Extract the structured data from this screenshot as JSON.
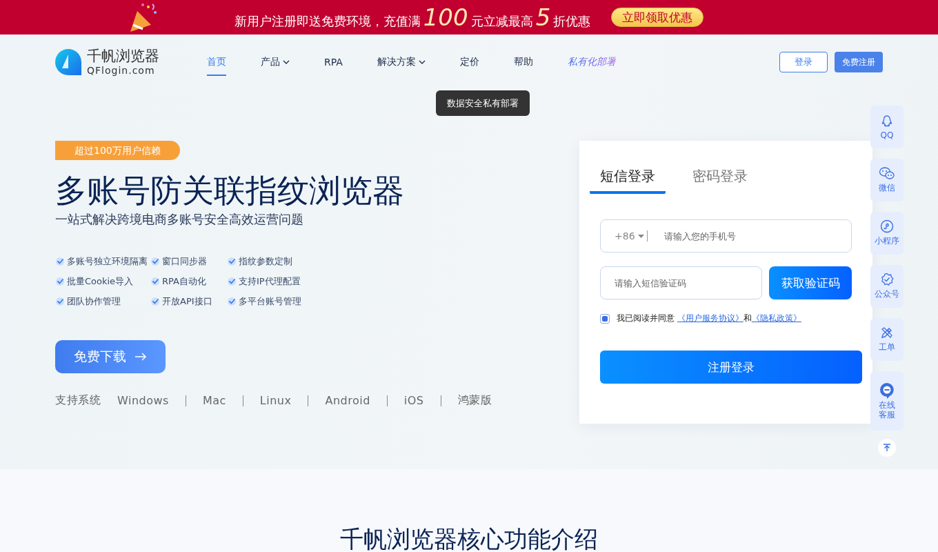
{
  "promo_banner": {
    "text_parts": [
      {
        "kind": "text",
        "text": "新用户注册即送免费环境，充值满"
      },
      {
        "kind": "number",
        "text": "100"
      },
      {
        "kind": "text",
        "text": "元立减最高"
      },
      {
        "kind": "number",
        "text": "5"
      },
      {
        "kind": "text",
        "text": "折优惠"
      }
    ],
    "button": "立即领取优惠"
  },
  "header": {
    "logo_name": "千帆浏览器",
    "logo_domain": "QFlogin.com",
    "nav": [
      {
        "label": "首页",
        "selected": true,
        "kind": "plain"
      },
      {
        "label": "产品",
        "selected": false,
        "kind": "dropdown"
      },
      {
        "label": "RPA",
        "selected": false,
        "kind": "plain"
      },
      {
        "label": "解决方案",
        "selected": false,
        "kind": "dropdown"
      },
      {
        "label": "定价",
        "selected": false,
        "kind": "plain"
      },
      {
        "label": "帮助",
        "selected": false,
        "kind": "plain"
      },
      {
        "label": "私有化部署",
        "selected": false,
        "kind": "special"
      }
    ],
    "tooltip": "数据安全私有部署",
    "login_button": "登录",
    "register_button": "免费注册"
  },
  "hero": {
    "badge": "超过100万用户信赖",
    "title": "多账号防关联指纹浏览器",
    "subtitle": "一站式解决跨境电商多账号安全高效运营问题",
    "features": [
      "多账号独立环境隔离",
      "窗口同步器",
      "指纹参数定制",
      "批量Cookie导入",
      "RPA自动化",
      "支持IP代理配置",
      "团队协作管理",
      "开放API接口",
      "多平台账号管理"
    ],
    "download_button": "免费下载",
    "platforms_label": "支持系统",
    "platforms": [
      "Windows",
      "Mac",
      "Linux",
      "Android",
      "iOS",
      "鸿蒙版"
    ]
  },
  "login": {
    "tabs": [
      {
        "label": "短信登录",
        "selected": true
      },
      {
        "label": "密码登录",
        "selected": false
      }
    ],
    "country_code": "+86",
    "phone_placeholder": "请输入您的手机号",
    "code_placeholder": "请输入短信验证码",
    "code_button": "获取验证码",
    "agreement": {
      "checked": true,
      "text": "我已阅读并同意",
      "terms_link": "《用户服务协议》",
      "conjunction": "和",
      "privacy_link": "《隐私政策》"
    },
    "submit": "注册登录"
  },
  "side_toolbar": [
    {
      "kind": "qq",
      "label": "QQ"
    },
    {
      "kind": "wechat",
      "label": "微信"
    },
    {
      "kind": "miniprogram",
      "label": "小程序"
    },
    {
      "kind": "official",
      "label": "公众号"
    },
    {
      "kind": "ticket",
      "label": "工单"
    },
    {
      "kind": "service",
      "label": "在线客服"
    }
  ],
  "section": {
    "title": "千帆浏览器核心功能介绍"
  }
}
